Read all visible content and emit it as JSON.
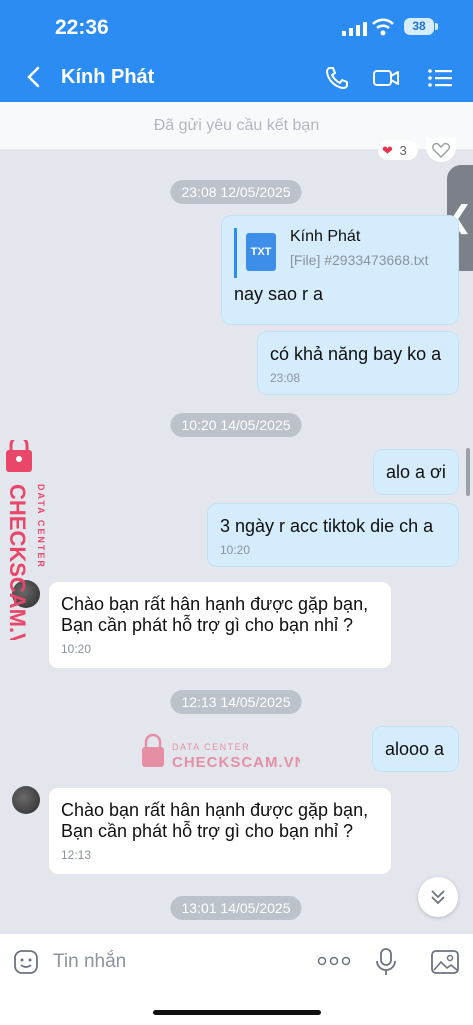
{
  "status_bar": {
    "time": "22:36",
    "battery": "38"
  },
  "header": {
    "contact_name": "Kính Phát"
  },
  "friend_request_banner": "Đã gửi yêu cầu kết bạn",
  "reaction": {
    "count": "3"
  },
  "conversation": {
    "date_1": "23:08 12/05/2025",
    "file_message": {
      "file_type": "TXT",
      "sender": "Kính Phát",
      "file_label": "[File] #2933473668.txt",
      "text": "nay sao r a"
    },
    "msg_fly": {
      "text": "có khả năng bay ko a",
      "time": "23:08"
    },
    "date_2": "10:20 14/05/2025",
    "msg_alo": {
      "text": "alo a ơi"
    },
    "msg_tiktok": {
      "text": "3 ngày r acc tiktok die ch a",
      "time": "10:20"
    },
    "msg_reply_1": {
      "line1": "Chào bạn rất hân hạnh được gặp bạn,",
      "line2": "Bạn cần phát hỗ trợ gì cho bạn nhỉ ?",
      "time": "10:20"
    },
    "date_3": "12:13 14/05/2025",
    "msg_alooo": {
      "text": "alooo a"
    },
    "msg_reply_2": {
      "line1": "Chào bạn rất hân hạnh được gặp bạn,",
      "line2": "Bạn cần phát hỗ trợ gì cho bạn nhỉ ?",
      "time": "12:13"
    },
    "date_4": "13:01 14/05/2025"
  },
  "watermark": {
    "top_text": "DATA CENTER",
    "brand": "CHECKSCAM.VN",
    "color": "#e8476a"
  },
  "input": {
    "placeholder": "Tin nhắn"
  },
  "colors": {
    "header": "#2b8cf3",
    "bubble_out": "#d4ecfb",
    "bubble_in": "#ffffff"
  },
  "icons": [
    "chevron-left-icon",
    "phone-icon",
    "video-icon",
    "menu-list-icon",
    "sticker-icon",
    "more-icon",
    "mic-icon",
    "image-icon",
    "chevron-down-double-icon"
  ]
}
